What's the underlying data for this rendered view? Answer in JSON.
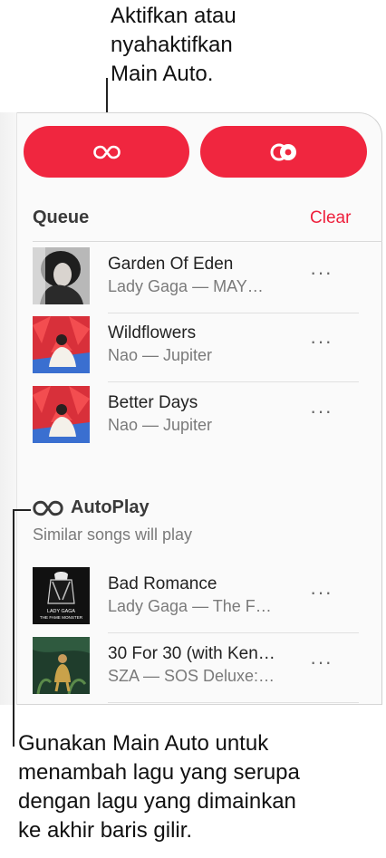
{
  "callouts": {
    "top": [
      "Aktifkan atau",
      "nyahaktifkan",
      "Main Auto."
    ],
    "bottom": [
      "Gunakan Main Auto untuk",
      "menambah lagu yang serupa",
      "dengan lagu yang dimainkan",
      "ke akhir baris gilir."
    ]
  },
  "buttons": {
    "autoplay_icon": "infinity-icon",
    "sync_icon": "sync-dot-icon"
  },
  "queue": {
    "title": "Queue",
    "clear_label": "Clear",
    "items": [
      {
        "title": "Garden Of Eden",
        "subtitle": "Lady Gaga — MAY…",
        "art": "album-art-mayhem",
        "more": "···"
      },
      {
        "title": "Wildflowers",
        "subtitle": "Nao — Jupiter",
        "art": "album-art-jupiter",
        "more": "···"
      },
      {
        "title": "Better Days",
        "subtitle": "Nao — Jupiter",
        "art": "album-art-jupiter",
        "more": "···"
      }
    ]
  },
  "autoplay": {
    "title": "AutoPlay",
    "subtitle": "Similar songs will play",
    "items": [
      {
        "title": "Bad Romance",
        "subtitle": "Lady Gaga — The F…",
        "art": "album-art-fame-monster",
        "art_caption": [
          "LADY GAGA",
          "THE FAME MONSTER"
        ],
        "more": "···"
      },
      {
        "title": "30 For 30 (with Ken…",
        "subtitle": "SZA — SOS Deluxe:…",
        "art": "album-art-sos-deluxe",
        "more": "···"
      }
    ]
  },
  "colors": {
    "accent": "#f0263f",
    "clear": "#ee1f3b"
  }
}
